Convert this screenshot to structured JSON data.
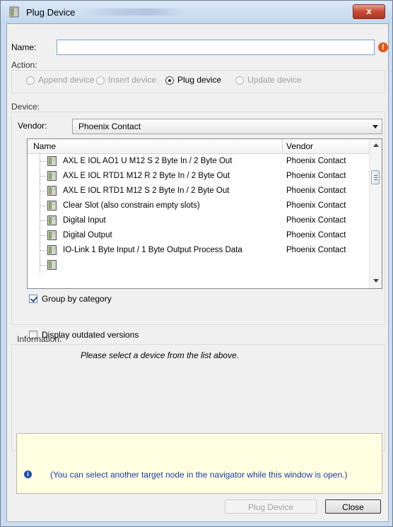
{
  "window": {
    "title": "Plug Device",
    "close_glyph": "x"
  },
  "name_field": {
    "label": "Name:",
    "value": "",
    "warning_glyph": "!"
  },
  "action": {
    "label": "Action:",
    "options": [
      {
        "label": "Append device",
        "selected": false,
        "enabled": false
      },
      {
        "label": "Insert device",
        "selected": false,
        "enabled": false
      },
      {
        "label": "Plug device",
        "selected": true,
        "enabled": true
      },
      {
        "label": "Update device",
        "selected": false,
        "enabled": false
      }
    ]
  },
  "device": {
    "label": "Device:",
    "vendor_label": "Vendor:",
    "vendor_value": "Phoenix Contact",
    "columns": {
      "name": "Name",
      "vendor": "Vendor"
    },
    "rows": [
      {
        "name": "AXL E IOL AO1 U M12 S  2 Byte In / 2 Byte Out",
        "vendor": "Phoenix Contact"
      },
      {
        "name": "AXL E IOL RTD1 M12 R  2 Byte In / 2 Byte Out",
        "vendor": "Phoenix Contact"
      },
      {
        "name": "AXL E IOL RTD1 M12 S  2 Byte In / 2 Byte Out",
        "vendor": "Phoenix Contact"
      },
      {
        "name": "Clear Slot (also constrain empty slots)",
        "vendor": "Phoenix Contact"
      },
      {
        "name": "Digital Input",
        "vendor": "Phoenix Contact"
      },
      {
        "name": "Digital Output",
        "vendor": "Phoenix Contact"
      },
      {
        "name": "IO-Link 1 Byte Input / 1 Byte Output Process Data",
        "vendor": "Phoenix Contact"
      }
    ],
    "group_by_category": {
      "label": "Group by category",
      "checked": true
    },
    "display_outdated": {
      "label": "Display outdated versions",
      "checked": false
    }
  },
  "information": {
    "label": "Information:",
    "text": "Please select a device from the list above."
  },
  "hint": {
    "icon": "i",
    "text": "(You can select another target node in the navigator while this window is open.)"
  },
  "buttons": {
    "plug": "Plug Device",
    "close": "Close"
  },
  "colors": {
    "titlebar": "#c3d7ee",
    "close_button": "#c54a35",
    "hint_text": "#1f3aa6",
    "hint_background": "#ffffe1",
    "warning": "#e05a1c"
  }
}
